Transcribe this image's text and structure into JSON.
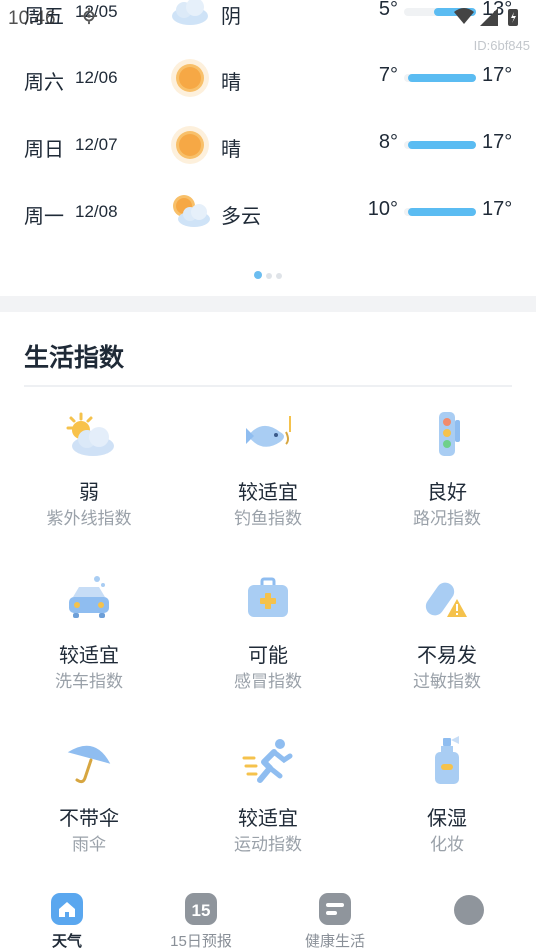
{
  "status_bar": {
    "time": "10:46",
    "icons": [
      "gear-icon",
      "wifi-icon",
      "signal-icon",
      "battery-icon"
    ]
  },
  "watermark": "ID:6bf845",
  "forecast": [
    {
      "day": "周五",
      "date": "12/05",
      "icon": "cloud-icon",
      "condition": "阴",
      "low": "5°",
      "high": "13°",
      "bar_start": 0.42,
      "bar_end": 1.0
    },
    {
      "day": "周六",
      "date": "12/06",
      "icon": "sun-icon",
      "condition": "晴",
      "low": "7°",
      "high": "17°",
      "bar_start": 0.05,
      "bar_end": 1.0
    },
    {
      "day": "周日",
      "date": "12/07",
      "icon": "sun-icon",
      "condition": "晴",
      "low": "8°",
      "high": "17°",
      "bar_start": 0.05,
      "bar_end": 1.0
    },
    {
      "day": "周一",
      "date": "12/08",
      "icon": "partly-cloudy-icon",
      "condition": "多云",
      "low": "10°",
      "high": "17°",
      "bar_start": 0.05,
      "bar_end": 1.0
    }
  ],
  "life": {
    "title": "生活指数",
    "items": [
      {
        "value": "弱",
        "label": "紫外线指数",
        "icon": "uv-sun-cloud-icon"
      },
      {
        "value": "较适宜",
        "label": "钓鱼指数",
        "icon": "fish-icon"
      },
      {
        "value": "良好",
        "label": "路况指数",
        "icon": "traffic-light-icon"
      },
      {
        "value": "较适宜",
        "label": "洗车指数",
        "icon": "car-wash-icon"
      },
      {
        "value": "可能",
        "label": "感冒指数",
        "icon": "medical-kit-icon"
      },
      {
        "value": "不易发",
        "label": "过敏指数",
        "icon": "allergy-pill-icon"
      },
      {
        "value": "不带伞",
        "label": "雨伞",
        "icon": "umbrella-icon"
      },
      {
        "value": "较适宜",
        "label": "运动指数",
        "icon": "running-icon"
      },
      {
        "value": "保湿",
        "label": "化妆",
        "icon": "cosmetic-bottle-icon"
      }
    ]
  },
  "nav": {
    "items": [
      {
        "label": "天气",
        "icon": "home-icon",
        "active": true
      },
      {
        "label": "15日预报",
        "icon": "calendar-15-icon",
        "badge": "15",
        "active": false
      },
      {
        "label": "健康生活",
        "icon": "health-list-icon",
        "active": false
      },
      {
        "label": "",
        "icon": "profile-icon",
        "active": false
      }
    ]
  },
  "colors": {
    "accent_blue": "#5bbcf2",
    "nav_active": "#4a90e2",
    "text_primary": "#1f2a37",
    "text_secondary": "#9aa1a9"
  }
}
